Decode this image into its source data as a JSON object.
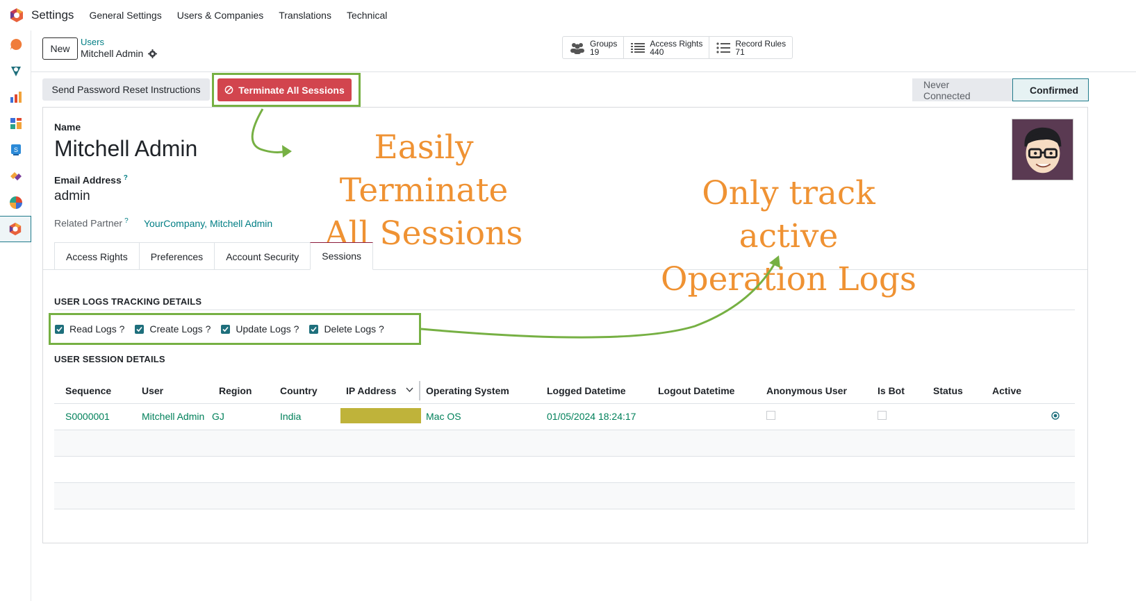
{
  "topbar": {
    "app_name": "Settings",
    "menu": [
      "General Settings",
      "Users & Companies",
      "Translations",
      "Technical"
    ]
  },
  "sidebar": {
    "icons": [
      "discuss-icon",
      "vpn-icon",
      "reporting-icon",
      "dashboard-icon",
      "documents-icon",
      "integration-icon",
      "pie-icon",
      "settings-icon"
    ]
  },
  "control": {
    "new_label": "New",
    "breadcrumb_parent": "Users",
    "breadcrumb_current": "Mitchell Admin",
    "stats": [
      {
        "label": "Groups",
        "value": "19"
      },
      {
        "label": "Access Rights",
        "value": "440"
      },
      {
        "label": "Record Rules",
        "value": "71"
      }
    ]
  },
  "actions": {
    "reset_label": "Send Password Reset Instructions",
    "terminate_label": "Terminate All Sessions"
  },
  "status": {
    "stages": [
      "Never Connected",
      "Confirmed"
    ],
    "current": "Confirmed"
  },
  "form": {
    "name_label": "Name",
    "name_value": "Mitchell Admin",
    "email_label": "Email Address",
    "email_help": "?",
    "email_value": "admin",
    "partner_label": "Related Partner",
    "partner_help": "?",
    "partner_value": "YourCompany, Mitchell Admin"
  },
  "tabs": [
    "Access Rights",
    "Preferences",
    "Account Security",
    "Sessions"
  ],
  "active_tab": "Sessions",
  "logs_section": {
    "title": "USER LOGS TRACKING DETAILS",
    "checks": [
      {
        "label": "Read Logs ?",
        "checked": true
      },
      {
        "label": "Create Logs ?",
        "checked": true
      },
      {
        "label": "Update Logs ?",
        "checked": true
      },
      {
        "label": "Delete Logs ?",
        "checked": true
      }
    ]
  },
  "session_section": {
    "title": "USER SESSION DETAILS",
    "columns": [
      "Sequence",
      "User",
      "Region",
      "Country",
      "IP Address",
      "Operating System",
      "Logged Datetime",
      "Logout Datetime",
      "Anonymous User",
      "Is Bot",
      "Status",
      "Active"
    ],
    "rows": [
      {
        "sequence": "S0000001",
        "user": "Mitchell Admin",
        "region": "GJ",
        "country": "India",
        "ip": "",
        "os": "Mac OS",
        "logged": "01/05/2024 18:24:17",
        "logout": "",
        "anonymous": false,
        "bot": false,
        "status": "",
        "active": true
      }
    ]
  },
  "annotations": {
    "terminate_line1": "Easily Terminate",
    "terminate_line2": "All Sessions",
    "logs_line1": "Only track active",
    "logs_line2": "Operation Logs",
    "color": "#ef9233",
    "highlight_color": "#76b043"
  }
}
